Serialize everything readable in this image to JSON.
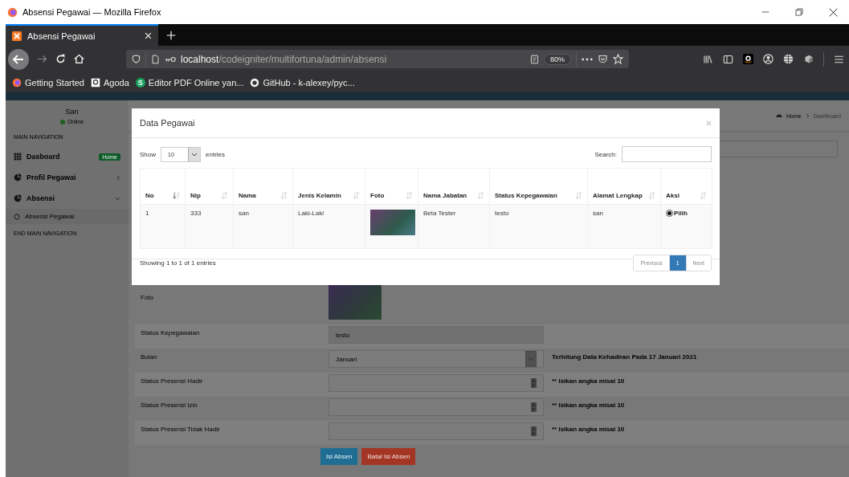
{
  "window": {
    "title": "Absensi Pegawai — Mozilla Firefox"
  },
  "tabs": [
    {
      "label": "Absensi Pegawai",
      "selected": true
    }
  ],
  "address_bar": {
    "host": "localhost",
    "path": "/codeigniter/multifortuna/admin/absensi",
    "zoom": "80%"
  },
  "bookmarks": [
    {
      "label": "Getting Started",
      "kind": "firefox"
    },
    {
      "label": "Agoda",
      "kind": "agoda"
    },
    {
      "label": "Editor PDF Online yan...",
      "kind": "letter",
      "icon_text": "S"
    },
    {
      "label": "GitHub - k-alexey/pyc...",
      "kind": "github"
    }
  ],
  "sidebar": {
    "user": "San",
    "status": "Online",
    "header": "MAIN NAVIGATION",
    "footer": "END MAIN NAVIGATION",
    "items": [
      {
        "label": "Dasboard",
        "kind": "grid",
        "badge": "Home"
      },
      {
        "label": "Profil Pegawai",
        "kind": "chart",
        "expanded": false
      },
      {
        "label": "Absensi",
        "kind": "chart",
        "expanded": true,
        "children": [
          {
            "label": "Absensi Pegawai"
          }
        ]
      }
    ]
  },
  "breadcrumb": [
    "Home",
    "Dashboard"
  ],
  "form": {
    "rows": [
      {
        "kind": "photo",
        "label": "Foto"
      },
      {
        "kind": "readonly",
        "label": "Status Kepegawaian",
        "value": "testo"
      },
      {
        "kind": "select",
        "label": "Bulan",
        "value": "Januari",
        "note": "Terhitung Data Kehadiran Pada 17 Januari 2021"
      },
      {
        "kind": "number",
        "label": "Status Presensi Hadir",
        "note": "** Isikan angka misal 10"
      },
      {
        "kind": "number",
        "label": "Status Presensi Izin",
        "note": "** Isikan angka misal 10"
      },
      {
        "kind": "number",
        "label": "Status Presensi Tidak Hadir",
        "note": "** Isikan angka misal 10"
      }
    ],
    "buttons": [
      {
        "label": "Isi Absen",
        "kind": "primary"
      },
      {
        "label": "Batal Isi Absen",
        "kind": "danger"
      }
    ]
  },
  "modal": {
    "title": "Data Pegawai",
    "show_label": "Show",
    "length": "10",
    "entries_label": "entries",
    "search_label": "Search:",
    "columns": [
      {
        "label": "No",
        "sorted": true
      },
      {
        "label": "Nip",
        "sorted": false
      },
      {
        "label": "Nama",
        "sorted": false
      },
      {
        "label": "Jenis Kelamin",
        "sorted": false
      },
      {
        "label": "Foto",
        "sorted": false
      },
      {
        "label": "Nama Jabatan",
        "sorted": false
      },
      {
        "label": "Status Kepegawaian",
        "sorted": false
      },
      {
        "label": "Alamat Lengkap",
        "sorted": false
      },
      {
        "label": "Aksi",
        "sorted": false
      }
    ],
    "rows": [
      {
        "no": "1",
        "nip": "333",
        "nama": "san",
        "jenis_kelamin": "Laki-Laki",
        "nama_jabatan": "Beta Tester",
        "status_kepegawaian": "testo",
        "alamat_lengkap": "san",
        "aksi": {
          "label": "Pilih",
          "checked": true
        }
      }
    ],
    "info": "Showing 1 to 1 of 1 entries",
    "pages": [
      {
        "label": "Previous",
        "selected": false
      },
      {
        "label": "1",
        "selected": true
      },
      {
        "label": "Next",
        "selected": false
      }
    ]
  }
}
